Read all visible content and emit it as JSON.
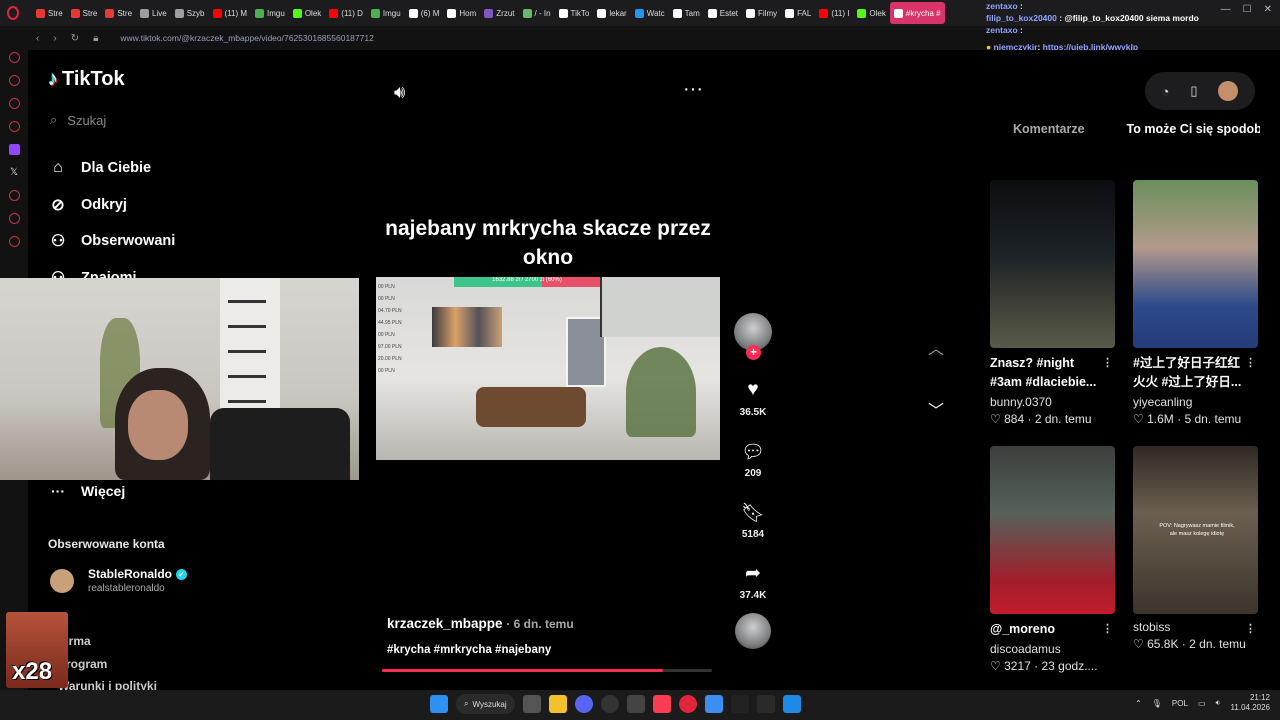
{
  "browser": {
    "tabs": [
      "Stre",
      "Stre",
      "Stre",
      "Live",
      "Szyb",
      "(11) M",
      "Imgu",
      "Olek",
      "(11) D",
      "Imgu",
      "(6) M",
      "Hom",
      "Zrzut",
      "/ - In",
      "TikTo",
      "lekar",
      "Watc",
      "Tam",
      "Estet",
      "Filmy",
      "FAL",
      "(11) I",
      "Olek",
      "#krycha #"
    ],
    "url": "www.tiktok.com/@krzaczek_mbappe/video/7625301685560187712"
  },
  "chat": [
    {
      "user": "zentaxo",
      "text": ""
    },
    {
      "user": "filip_to_kox20400",
      "text": "@filip_to_kox20400 siema mordo"
    },
    {
      "user": "zentaxo",
      "text": ""
    },
    {
      "user": "niemczykjr",
      "text": "https://ujeb.link/wwyklp"
    }
  ],
  "tiktok": {
    "logo": "TikTok",
    "search_placeholder": "Szukaj",
    "nav": [
      "Dla Ciebie",
      "Odkryj",
      "Obserwowani",
      "Znajomi"
    ],
    "more": "Więcej",
    "following_title": "Obserwowane konta",
    "account": {
      "name": "StableRonaldo",
      "handle": "realstableronaldo"
    },
    "footer": [
      "Firma",
      "Program",
      "Warunki i polityki"
    ]
  },
  "overlay": {
    "multiplier": "x28"
  },
  "video": {
    "caption": "najebany mrkrycha skacze przez okno",
    "author": "krzaczek_mbappe",
    "age": "· 6 dn. temu",
    "hashtags": "#krycha #mrkrycha #najebany",
    "progress": 0.85,
    "stream_bar": "1632.88 zł / 2700 zł (60%)",
    "stream_pln": [
      "00 PLN",
      "00 PLN",
      "04.70 PLN",
      "44.95 PLN",
      "00 PLN",
      "97.00 PLN",
      "20.00 PLN",
      "00 PLN"
    ]
  },
  "actions": {
    "likes": "36.5K",
    "comments": "209",
    "saves": "5184",
    "shares": "37.4K"
  },
  "right_panel": {
    "tabs": [
      "Komentarze",
      "To może Ci się spodobać"
    ],
    "cards": [
      {
        "title": "Znasz? #night #3am #dlaciebie...",
        "user": "bunny.0370",
        "likes": "884",
        "age": "2 dn. temu"
      },
      {
        "title": "#过上了好日子红红火火 #过上了好日...",
        "user": "yiyecanling",
        "likes": "1.6M",
        "age": "5 dn. temu"
      },
      {
        "title": "@_moreno",
        "user": "discoadamus",
        "likes": "3217",
        "age": "23 godz...."
      },
      {
        "title": "",
        "user": "stobiss",
        "likes": "65.8K",
        "age": "2 dn. temu",
        "thumb_text": "POV: Nagrywasz mamie filmik, ale masz kolegę idiotę"
      }
    ]
  },
  "taskbar": {
    "search": "Wyszukaj",
    "lang": "POL",
    "time": "21:12",
    "date": "11.04.2026"
  }
}
